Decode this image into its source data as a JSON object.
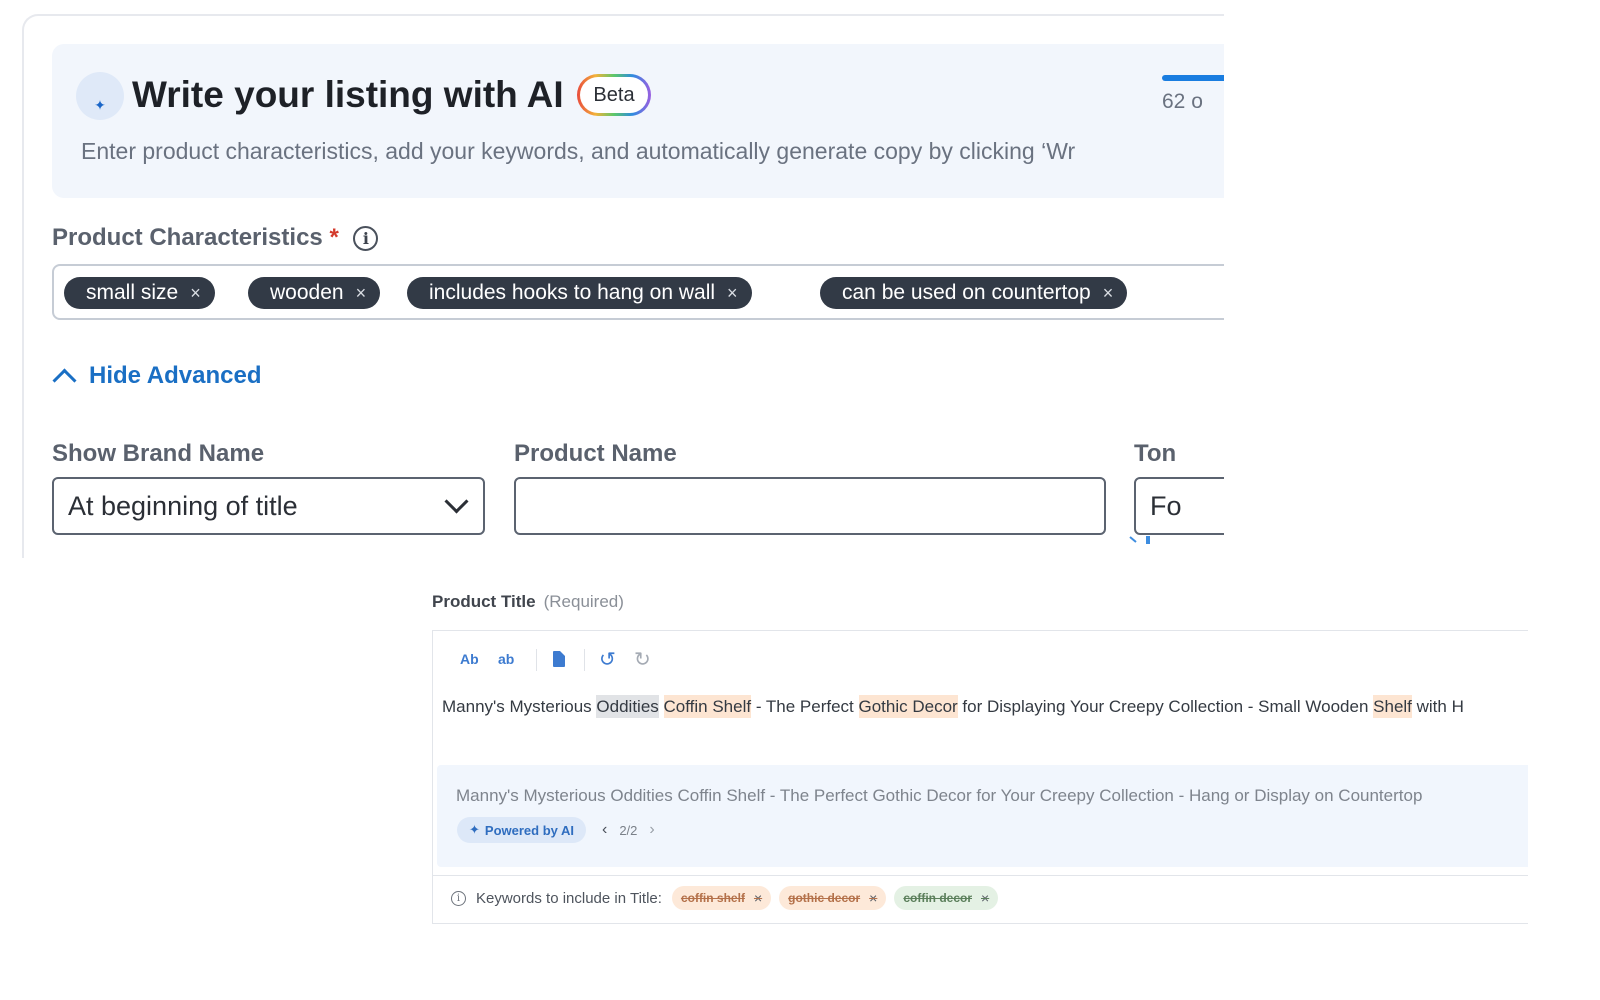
{
  "ai_panel": {
    "sparkle_icon": "✦",
    "title": "Write your listing with AI",
    "beta_badge": "Beta",
    "progress_text": "62 o",
    "description": "Enter product characteristics, add your keywords, and automatically generate copy by clicking ‘Wr"
  },
  "characteristics": {
    "label": "Product Characteristics",
    "required_marker": "*",
    "info_icon": "i",
    "chips": [
      {
        "label": "small size",
        "remove": "×"
      },
      {
        "label": "wooden",
        "remove": "×"
      },
      {
        "label": "includes hooks to hang on wall",
        "remove": "×"
      },
      {
        "label": "can be used on countertop",
        "remove": "×"
      }
    ]
  },
  "advanced": {
    "toggle_label": "Hide Advanced"
  },
  "brand": {
    "label": "Show Brand Name",
    "selected": "At beginning of title"
  },
  "product_name": {
    "label": "Product Name",
    "value": ""
  },
  "tone": {
    "label": "Ton",
    "value": "Fo"
  },
  "product_title": {
    "label": "Product Title",
    "required_note": "(Required)",
    "toolbar": {
      "capitalize": "Ab",
      "lowercase": "ab",
      "undo": "↺",
      "redo": "↻"
    },
    "editor_segments": [
      {
        "text": "Manny's Mysterious ",
        "hl": ""
      },
      {
        "text": "Oddities",
        "hl": "gray"
      },
      {
        "text": " ",
        "hl": ""
      },
      {
        "text": "Coffin Shelf",
        "hl": "orange"
      },
      {
        "text": " - The Perfect ",
        "hl": ""
      },
      {
        "text": "Gothic Decor",
        "hl": "orange"
      },
      {
        "text": " for Displaying Your Creepy Collection - Small Wooden ",
        "hl": ""
      },
      {
        "text": "Shelf",
        "hl": "orange"
      },
      {
        "text": " with H",
        "hl": ""
      }
    ],
    "suggestion": "Manny's Mysterious Oddities Coffin Shelf - The Perfect Gothic Decor for Your Creepy Collection - Hang or Display on Countertop",
    "powered_by": "Powered by AI",
    "pager": {
      "prev": "‹",
      "count": "2/2",
      "next": "›"
    },
    "keywords": {
      "info_icon": "i",
      "label": "Keywords to include in Title:",
      "chips": [
        {
          "label": "coffin shelf",
          "color": "orange",
          "remove": "×"
        },
        {
          "label": "gothic decor",
          "color": "orange",
          "remove": "×"
        },
        {
          "label": "coffin decor",
          "color": "green",
          "remove": "×"
        }
      ]
    }
  },
  "colors": {
    "accent_blue": "#1a6fc4",
    "chip_dark": "#323a46",
    "required_red": "#d33a2c",
    "keyword_orange": "#fde9d9",
    "keyword_green": "#e4f1e4"
  }
}
